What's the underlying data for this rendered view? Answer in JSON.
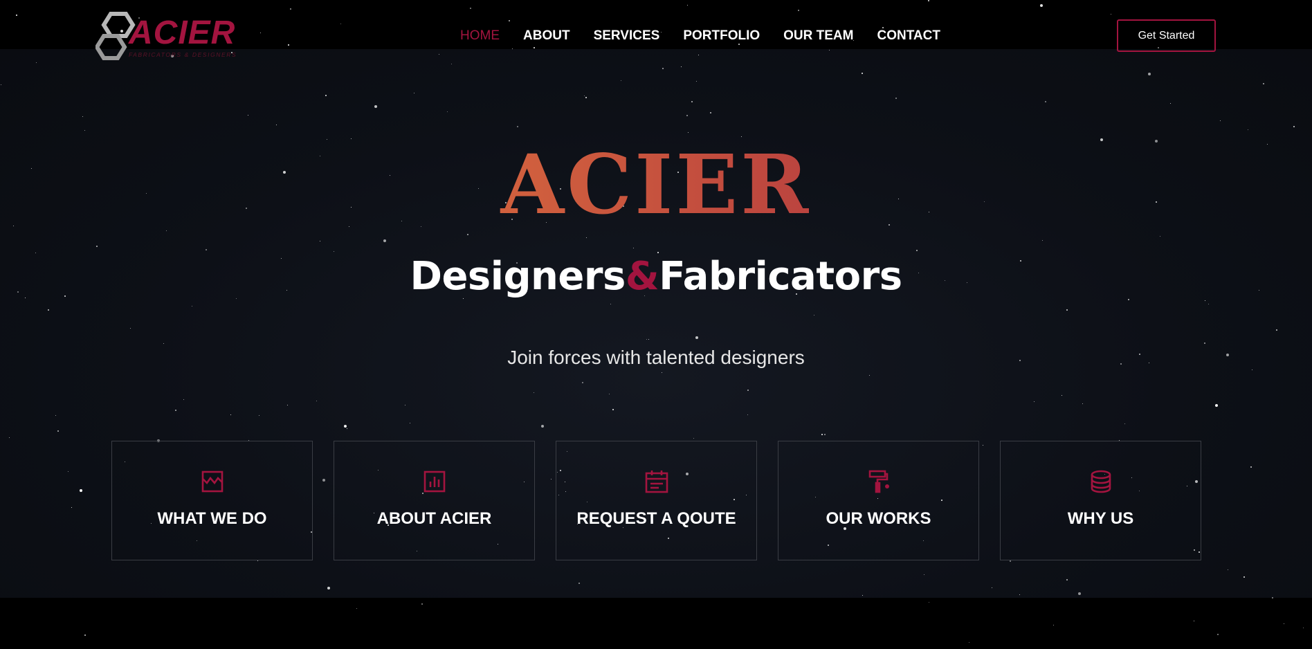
{
  "brand": {
    "logo_word": "ACIER",
    "logo_sub": "FABRICATORS & DESIGNERS",
    "accent": "#a3143f"
  },
  "nav": {
    "items": [
      {
        "label": "HOME",
        "active": true
      },
      {
        "label": "ABOUT",
        "active": false
      },
      {
        "label": "SERVICES",
        "active": false
      },
      {
        "label": "PORTFOLIO",
        "active": false
      },
      {
        "label": "OUR TEAM",
        "active": false
      },
      {
        "label": "CONTACT",
        "active": false
      }
    ],
    "cta_label": "Get Started"
  },
  "hero": {
    "logo_text": "ACIER",
    "headline_part1": "Designers",
    "headline_amp": "&",
    "headline_part2": "Fabricators",
    "tagline": "Join forces with talented designers"
  },
  "cards": [
    {
      "title": "WHAT WE DO",
      "icon": "store-icon"
    },
    {
      "title": "ABOUT ACIER",
      "icon": "bar-chart-icon"
    },
    {
      "title": "REQUEST A QOUTE",
      "icon": "calendar-icon"
    },
    {
      "title": "OUR WORKS",
      "icon": "paint-roller-icon"
    },
    {
      "title": "WHY US",
      "icon": "database-icon"
    }
  ]
}
